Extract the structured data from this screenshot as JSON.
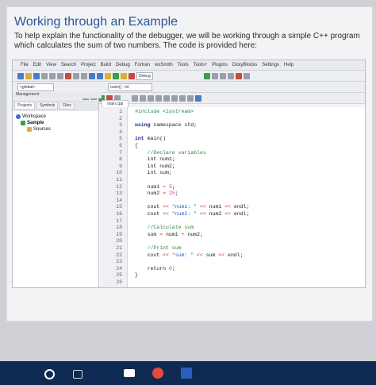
{
  "document": {
    "heading": "Working through an Example",
    "intro": "To help explain the functionality of the debugger, we will be working through a simple C++ program which calculates the sum of two numbers. The code is provided here:"
  },
  "ide": {
    "menus": [
      "File",
      "Edit",
      "View",
      "Search",
      "Project",
      "Build",
      "Debug",
      "Fortran",
      "wxSmith",
      "Tools",
      "Tools+",
      "Plugins",
      "DoxyBlocks",
      "Settings",
      "Help"
    ],
    "scope_select": "<global>",
    "function_select": "main() : int",
    "build_target": "Debug",
    "management_title": "Management",
    "management_tabs": [
      "Projects",
      "Symbols",
      "Files"
    ],
    "tree": {
      "workspace": "Workspace",
      "project": "Sample",
      "folder": "Sources"
    },
    "editor_tab": "main.cpp",
    "lines": [
      {
        "n": "1",
        "code": "#include <iostream>"
      },
      {
        "n": "2",
        "code": ""
      },
      {
        "n": "3",
        "code": "using namespace std;"
      },
      {
        "n": "4",
        "code": ""
      },
      {
        "n": "5",
        "code": "int main()"
      },
      {
        "n": "6",
        "code": "{"
      },
      {
        "n": "7",
        "code": "    //Declare variables"
      },
      {
        "n": "8",
        "code": "    int num1;"
      },
      {
        "n": "9",
        "code": "    int num2;"
      },
      {
        "n": "10",
        "code": "    int sum;"
      },
      {
        "n": "11",
        "code": ""
      },
      {
        "n": "12",
        "code": "    num1 = 5;"
      },
      {
        "n": "13",
        "code": "    num2 = 25;"
      },
      {
        "n": "14",
        "code": ""
      },
      {
        "n": "15",
        "code": "    cout << \"num1: \" << num1 << endl;"
      },
      {
        "n": "16",
        "code": "    cout << \"num2: \" << num2 << endl;"
      },
      {
        "n": "17",
        "code": ""
      },
      {
        "n": "18",
        "code": "    //Calculate sum"
      },
      {
        "n": "19",
        "code": "    sum = num1 + num2;"
      },
      {
        "n": "20",
        "code": ""
      },
      {
        "n": "21",
        "code": "    //Print sum"
      },
      {
        "n": "22",
        "code": "    cout << \"sum: \" << sum << endl;"
      },
      {
        "n": "23",
        "code": ""
      },
      {
        "n": "24",
        "code": "    return 0;"
      },
      {
        "n": "25",
        "code": "}"
      },
      {
        "n": "26",
        "code": ""
      }
    ]
  }
}
